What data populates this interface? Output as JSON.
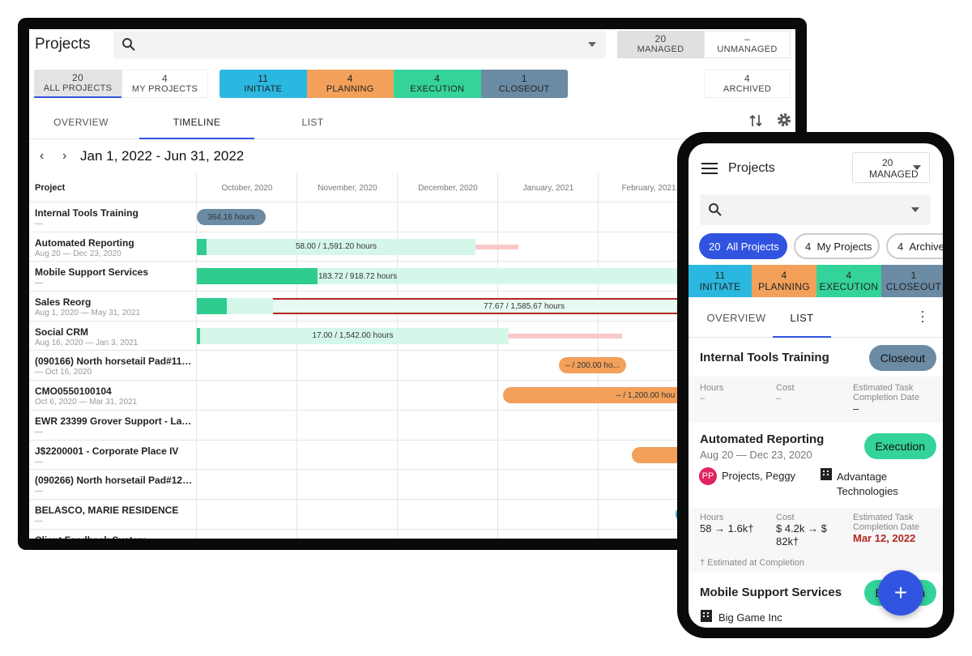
{
  "desktop": {
    "title": "Projects",
    "search": {
      "placeholder": "",
      "icon": "search-icon"
    },
    "managed": {
      "count": "20",
      "label": "MANAGED"
    },
    "unmanaged": {
      "count": "–",
      "label": "UNMANAGED"
    },
    "filters": [
      {
        "count": "20",
        "label": "ALL PROJECTS"
      },
      {
        "count": "4",
        "label": "MY PROJECTS"
      }
    ],
    "phases": [
      {
        "count": "11",
        "label": "INITIATE",
        "color": "#2bb8e0"
      },
      {
        "count": "4",
        "label": "PLANNING",
        "color": "#f2a05a"
      },
      {
        "count": "4",
        "label": "EXECUTION",
        "color": "#34d399"
      },
      {
        "count": "1",
        "label": "CLOSEOUT",
        "color": "#6b8ba4"
      }
    ],
    "archived": {
      "count": "4",
      "label": "ARCHIVED"
    },
    "tabs": [
      "OVERVIEW",
      "TIMELINE",
      "LIST"
    ],
    "active_tab": "TIMELINE",
    "date_range": "Jan 1, 2022 - Jun 31, 2022",
    "grid_header": "Project",
    "months": [
      "October, 2020",
      "November, 2020",
      "December, 2020",
      "January, 2021",
      "February, 2021"
    ],
    "projects": [
      {
        "name": "Internal Tools Training",
        "dates": "—",
        "bar": "364.16 hours"
      },
      {
        "name": "Automated Reporting",
        "dates": "Aug 20 — Dec 23, 2020",
        "bar": "58.00 / 1,591.20 hours"
      },
      {
        "name": "Mobile Support Services",
        "dates": "—",
        "bar": "183.72 / 918.72 hours"
      },
      {
        "name": "Sales Reorg",
        "dates": "Aug 1, 2020 — May 31, 2021",
        "bar": "77.67 / 1,585.67 hours"
      },
      {
        "name": "Social CRM",
        "dates": "Aug 16, 2020 — Jan 3, 2021",
        "bar": "17.00 / 1,542.00 hours"
      },
      {
        "name": "(090166) North horsetail Pad#11 P...",
        "dates": "— Oct 16, 2020",
        "bar": "– / 200.00 ho..."
      },
      {
        "name": "CMO0550100104",
        "dates": "Oct 6, 2020 — Mar 31, 2021",
        "bar": "– / 1,200.00 hou"
      },
      {
        "name": "EWR 23399 Grover Support - Lawr...",
        "dates": "—",
        "bar": ""
      },
      {
        "name": "J$2200001 - Corporate Place IV",
        "dates": "—",
        "bar": ""
      },
      {
        "name": "(090266) North horsetail Pad#12 P...",
        "dates": "—",
        "bar": ""
      },
      {
        "name": "BELASCO, MARIE RESIDENCE",
        "dates": "—",
        "bar": ""
      },
      {
        "name": "Client Feedback System",
        "dates": "",
        "bar": ""
      }
    ]
  },
  "mobile": {
    "title": "Projects",
    "managed": {
      "count": "20",
      "label": "MANAGED"
    },
    "chips": [
      {
        "count": "20",
        "label": "All Projects"
      },
      {
        "count": "4",
        "label": "My Projects"
      },
      {
        "count": "4",
        "label": "Archived"
      }
    ],
    "phases": [
      {
        "count": "11",
        "label": "INITIATE"
      },
      {
        "count": "4",
        "label": "PLANNING"
      },
      {
        "count": "4",
        "label": "EXECUTION"
      },
      {
        "count": "1",
        "label": "CLOSEOUT"
      }
    ],
    "tabs": [
      "OVERVIEW",
      "LIST"
    ],
    "active_tab": "LIST",
    "cards": [
      {
        "name": "Internal Tools Training",
        "status": "Closeout",
        "hours_label": "Hours",
        "hours": "–",
        "cost_label": "Cost",
        "cost": "–",
        "est_label": "Estimated Task Completion Date",
        "est": "–"
      },
      {
        "name": "Automated Reporting",
        "dates": "Aug 20 — Dec 23, 2020",
        "status": "Execution",
        "avatar": "PP",
        "owner": "Projects, Peggy",
        "company": "Advantage Technologies",
        "hours_label": "Hours",
        "hours": "58 → 1.6k†",
        "cost_label": "Cost",
        "cost": "$ 4.2k → $ 82k†",
        "est_label": "Estimated Task Completion Date",
        "est": "Mar 12, 2022",
        "footnote": "† Estimated at Completion"
      },
      {
        "name": "Mobile Support Services",
        "status": "Execution",
        "company": "Big Game Inc"
      }
    ],
    "fab": "+"
  }
}
